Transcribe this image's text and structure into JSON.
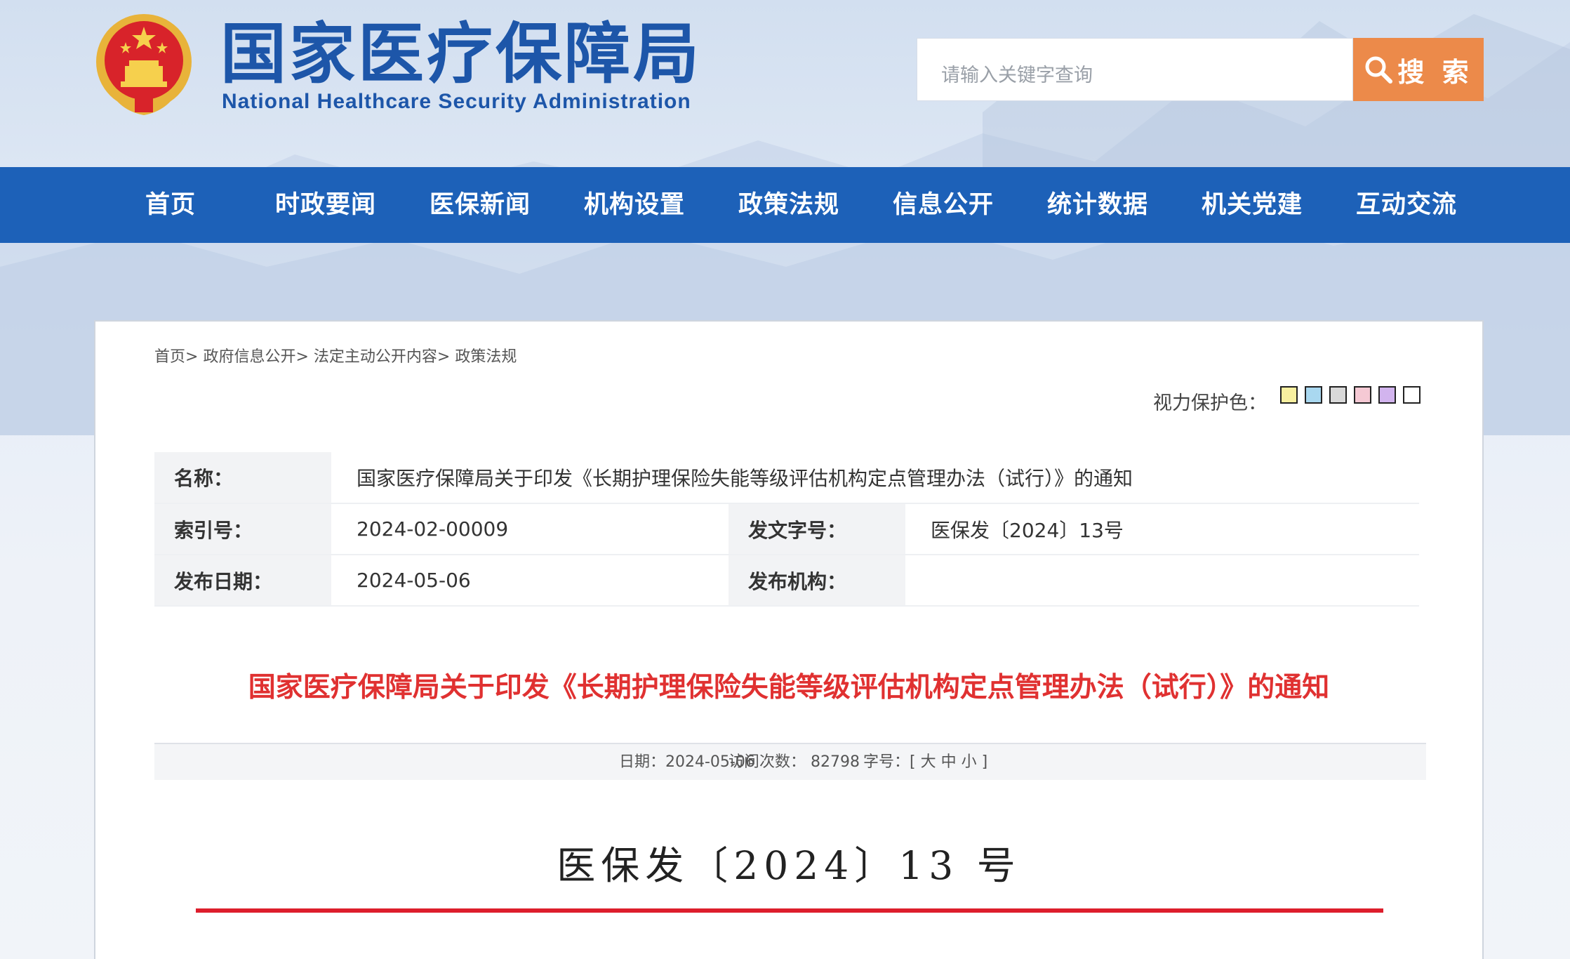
{
  "header": {
    "title": "国家医疗保障局",
    "subtitle": "National Healthcare Security Administration",
    "search_placeholder": "请输入关键字查询",
    "search_button": "搜 索"
  },
  "nav": {
    "items": [
      "首页",
      "时政要闻",
      "医保新闻",
      "机构设置",
      "政策法规",
      "信息公开",
      "统计数据",
      "机关党建",
      "互动交流"
    ]
  },
  "breadcrumb": {
    "items": [
      "首页>",
      "政府信息公开>",
      "法定主动公开内容>",
      "政策法规"
    ]
  },
  "vision": {
    "label": "视力保护色：",
    "colors": [
      "#f8f0a0",
      "#a9d8f0",
      "#d9d9d9",
      "#f5c9d4",
      "#d2b4ee",
      "#ffffff"
    ]
  },
  "info": {
    "name_label": "名称：",
    "name_value": "国家医疗保障局关于印发《长期护理保险失能等级评估机构定点管理办法（试行）》的通知",
    "index_label": "索引号：",
    "index_value": "2024-02-00009",
    "docno_label": "发文字号：",
    "docno_value": "医保发〔2024〕13号",
    "date_label": "发布日期：",
    "date_value": "2024-05-06",
    "org_label": "发布机构：",
    "org_value": ""
  },
  "doc": {
    "title": "国家医疗保障局关于印发《长期护理保险失能等级评估机构定点管理办法（试行）》的通知",
    "date_text": "日期：2024-05-06",
    "visits_text": "访问次数：  82798",
    "font_label": "字号：[",
    "font_large": "大",
    "font_medium": "中",
    "font_small": "小",
    "font_close": "]",
    "number": "医保发〔2024〕13 号"
  },
  "colors": {
    "brand_blue": "#1d56a9",
    "nav_blue": "#1d61b8",
    "search_orange": "#ec8a4a",
    "title_red": "#e03131",
    "rule_red": "#dd1e2c"
  }
}
